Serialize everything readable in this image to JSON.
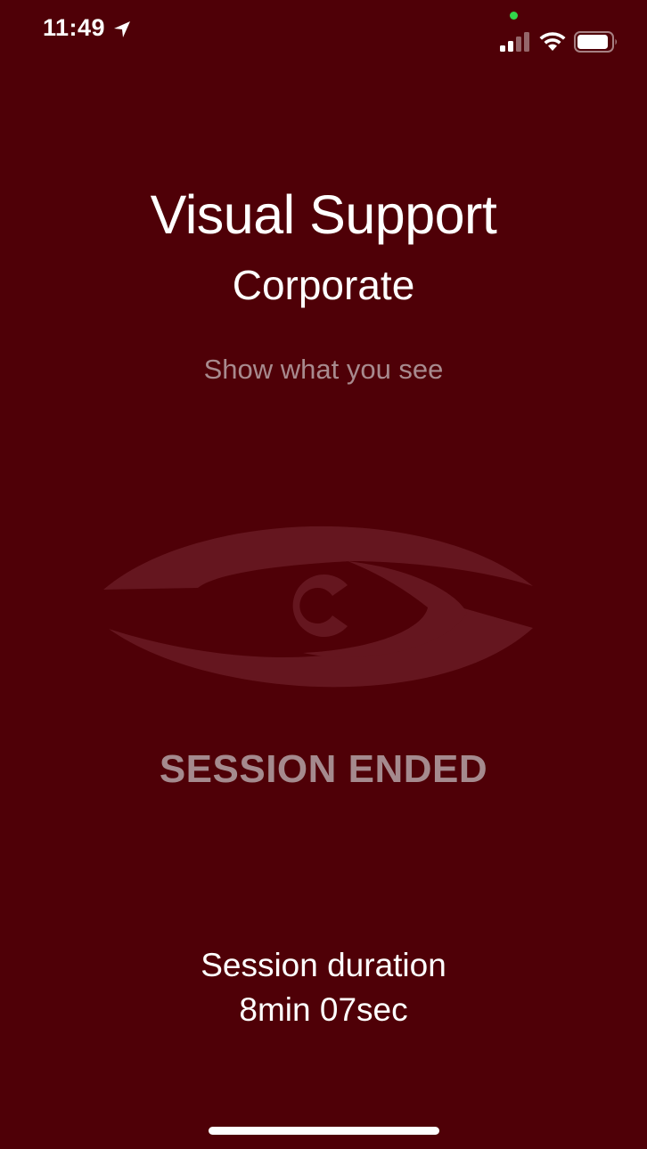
{
  "status_bar": {
    "time": "11:49",
    "icons": [
      "location-arrow-icon",
      "signal-icon",
      "wifi-icon",
      "battery-icon"
    ],
    "privacy_dot_color": "#32d74b"
  },
  "header": {
    "title": "Visual Support",
    "subtitle": "Corporate",
    "tagline": "Show what you see"
  },
  "logo": {
    "icon": "eye-logo-icon",
    "letter": "C"
  },
  "status": {
    "message": "SESSION ENDED"
  },
  "session": {
    "duration_label": "Session duration",
    "duration_value": "8min 07sec"
  },
  "colors": {
    "background": "#4f0007",
    "text_primary": "#ffffff",
    "text_muted": "#a88a8e",
    "logo": "#65161f"
  }
}
